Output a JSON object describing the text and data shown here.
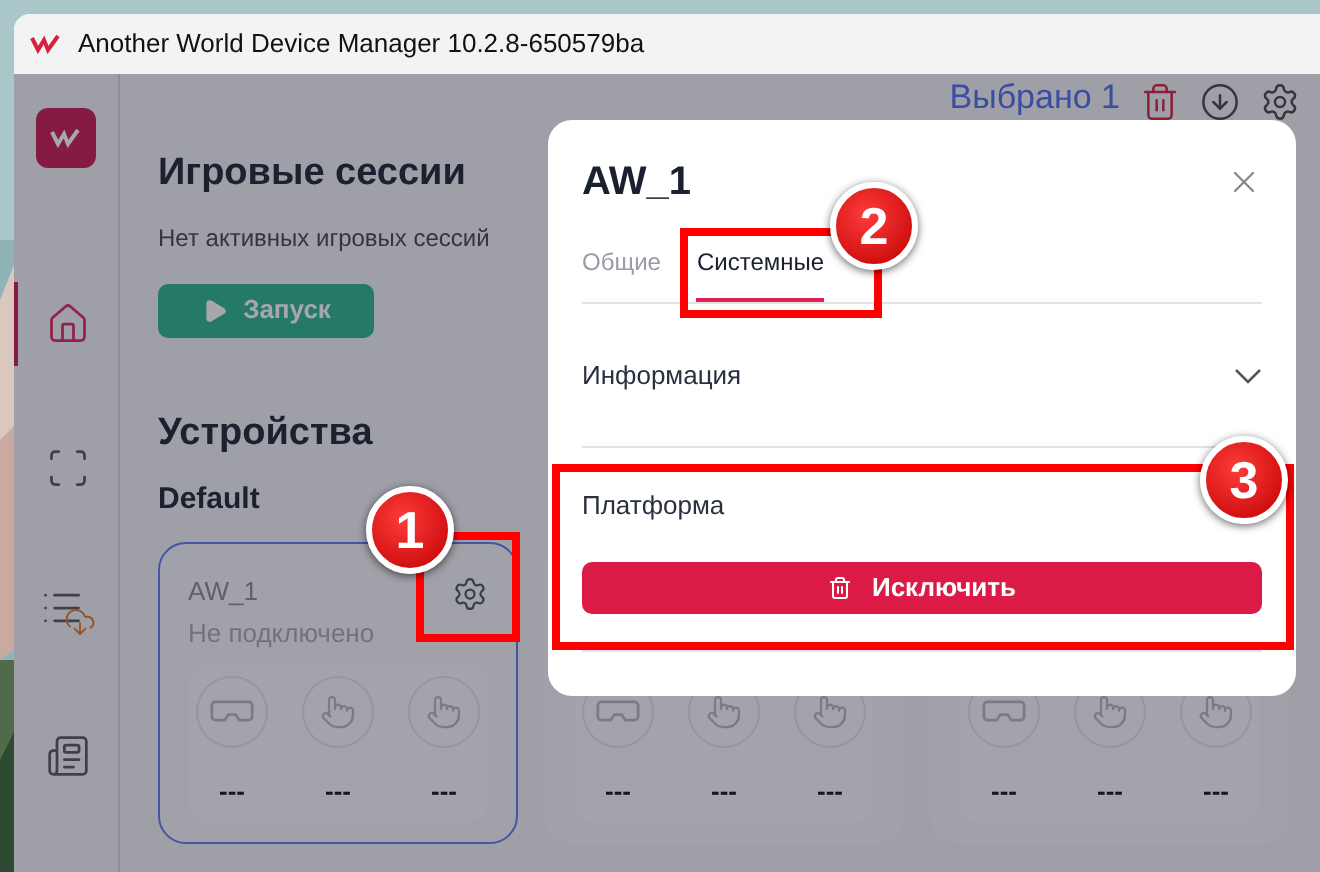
{
  "window": {
    "title": "Another World Device Manager 10.2.8-650579ba"
  },
  "sidebar": {
    "items": [
      {
        "kind": "home",
        "selected": true
      },
      {
        "kind": "scan",
        "selected": false
      },
      {
        "kind": "downloads",
        "selected": false
      },
      {
        "kind": "news",
        "selected": false
      }
    ]
  },
  "top_bar": {
    "selection": "Выбрано 1"
  },
  "sessions": {
    "title": "Игровые сессии",
    "empty_text": "Нет активных игровых сессий",
    "launch_button": "Запуск"
  },
  "devices": {
    "title": "Устройства",
    "group": "Default",
    "cards": [
      {
        "name": "AW_1",
        "status": "Не подключено",
        "selected": true,
        "readings": [
          "---",
          "---",
          "---"
        ]
      },
      {
        "selected": false,
        "readings": [
          "---",
          "---",
          "---"
        ]
      },
      {
        "selected": false,
        "readings": [
          "---",
          "---",
          "---"
        ]
      }
    ]
  },
  "dialog": {
    "title": "AW_1",
    "tabs": [
      {
        "label": "Общие",
        "selected": false
      },
      {
        "label": "Системные",
        "selected": true
      }
    ],
    "sections": [
      {
        "kind": "accordion",
        "title": "Информация",
        "expanded": false
      },
      {
        "kind": "action",
        "title": "Платформа",
        "button": "Исключить"
      }
    ]
  },
  "annotations": [
    {
      "label": "1"
    },
    {
      "label": "2"
    },
    {
      "label": "3"
    }
  ]
}
